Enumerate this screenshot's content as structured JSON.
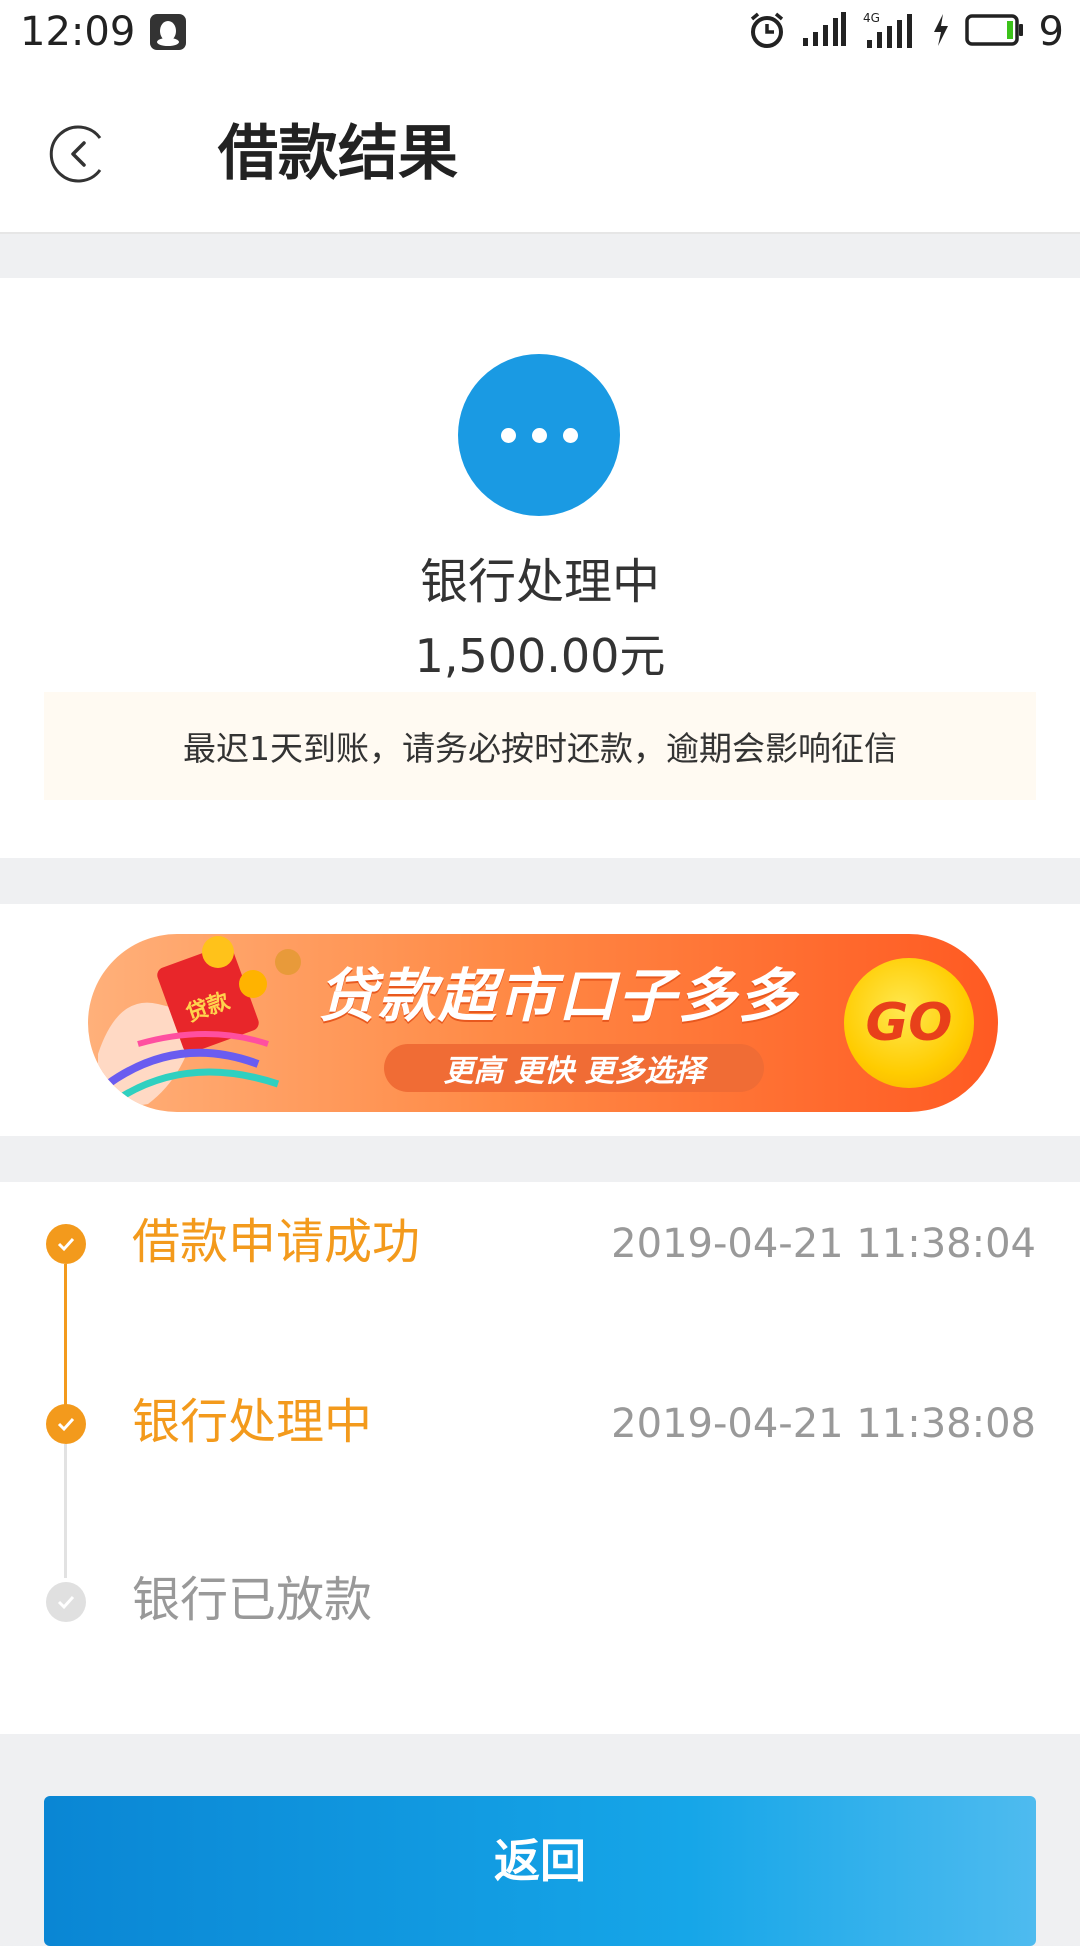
{
  "status_bar": {
    "time": "12:09",
    "battery_level": "9",
    "network": "4G",
    "icons": [
      "qq-icon",
      "alarm-icon",
      "signal-icon",
      "4g-signal-icon",
      "charging-icon",
      "battery-icon"
    ]
  },
  "header": {
    "title": "借款结果",
    "back_icon": "chevron-left-circle-icon"
  },
  "result": {
    "status": "银行处理中",
    "amount": "1,500.00元",
    "notice": "最迟1天到账，请务必按时还款，逾期会影响征信",
    "icon": "ellipsis-icon",
    "icon_color": "#1a9ae3"
  },
  "banner": {
    "title": "贷款超市口子多多",
    "subtitle": "更高  更快  更多选择",
    "go_label": "GO",
    "tag": "贷款"
  },
  "timeline": {
    "steps": [
      {
        "label": "借款申请成功",
        "time": "2019-04-21 11:38:04",
        "state": "done"
      },
      {
        "label": "银行处理中",
        "time": "2019-04-21 11:38:08",
        "state": "done"
      },
      {
        "label": "银行已放款",
        "time": "",
        "state": "pending"
      }
    ],
    "active_color": "#f39a1c",
    "inactive_color": "#d9d9d9"
  },
  "footer": {
    "button_label": "返回"
  }
}
